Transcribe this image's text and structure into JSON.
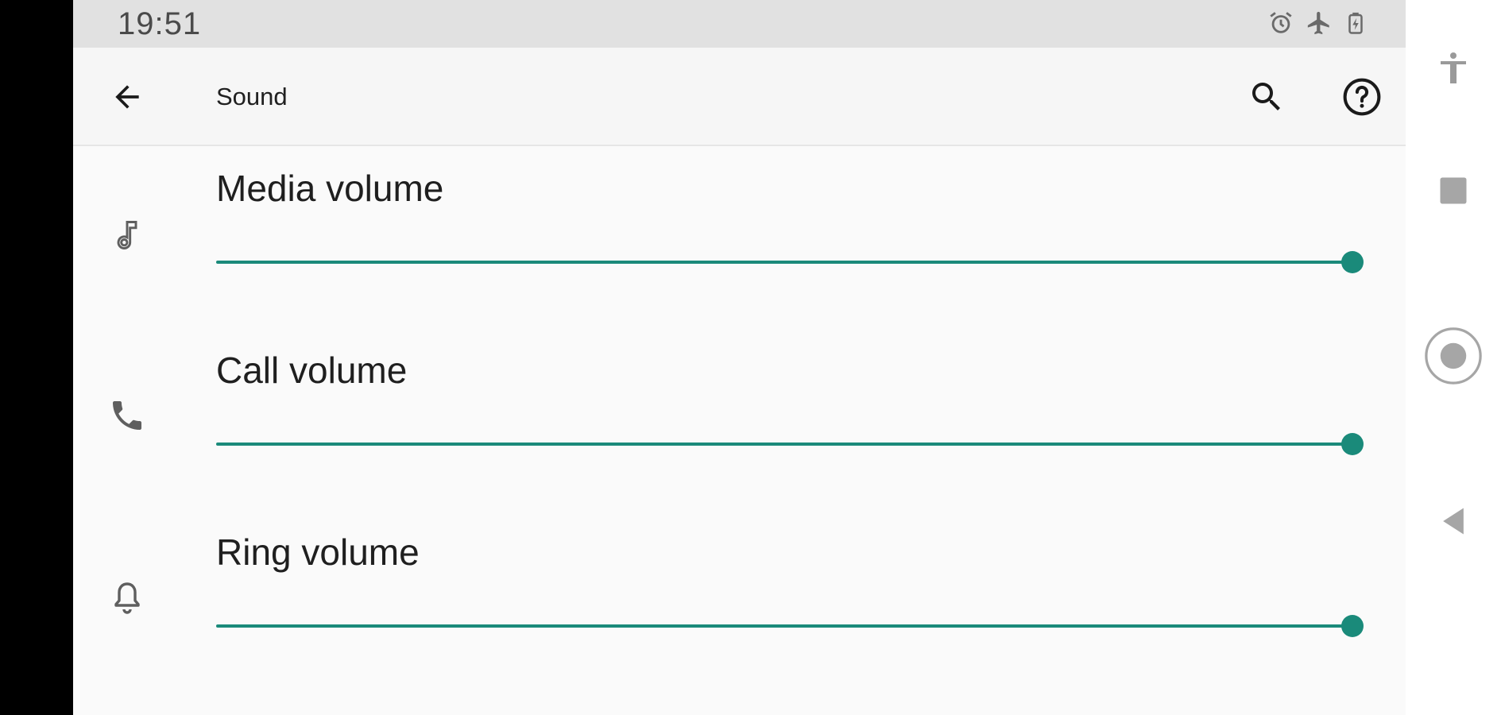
{
  "status_bar": {
    "time": "19:51",
    "icons": [
      "alarm-icon",
      "airplane-mode-icon",
      "battery-charging-icon"
    ]
  },
  "app_bar": {
    "title": "Sound",
    "back_icon": "arrow-back-icon",
    "search_icon": "search-icon",
    "help_icon": "help-icon"
  },
  "settings": [
    {
      "label": "Media volume",
      "icon": "music-note-icon",
      "value_fraction": 1.0
    },
    {
      "label": "Call volume",
      "icon": "phone-icon",
      "value_fraction": 1.0
    },
    {
      "label": "Ring volume",
      "icon": "bell-icon",
      "value_fraction": 1.0
    }
  ],
  "nav_bar": {
    "buttons": [
      "accessibility-icon",
      "recents-icon",
      "home-icon",
      "back-icon"
    ]
  },
  "colors": {
    "accent": "#1a8a7a",
    "background": "#fafafa",
    "status_bar": "#e1e1e1",
    "icon": "#5f5f5f"
  }
}
